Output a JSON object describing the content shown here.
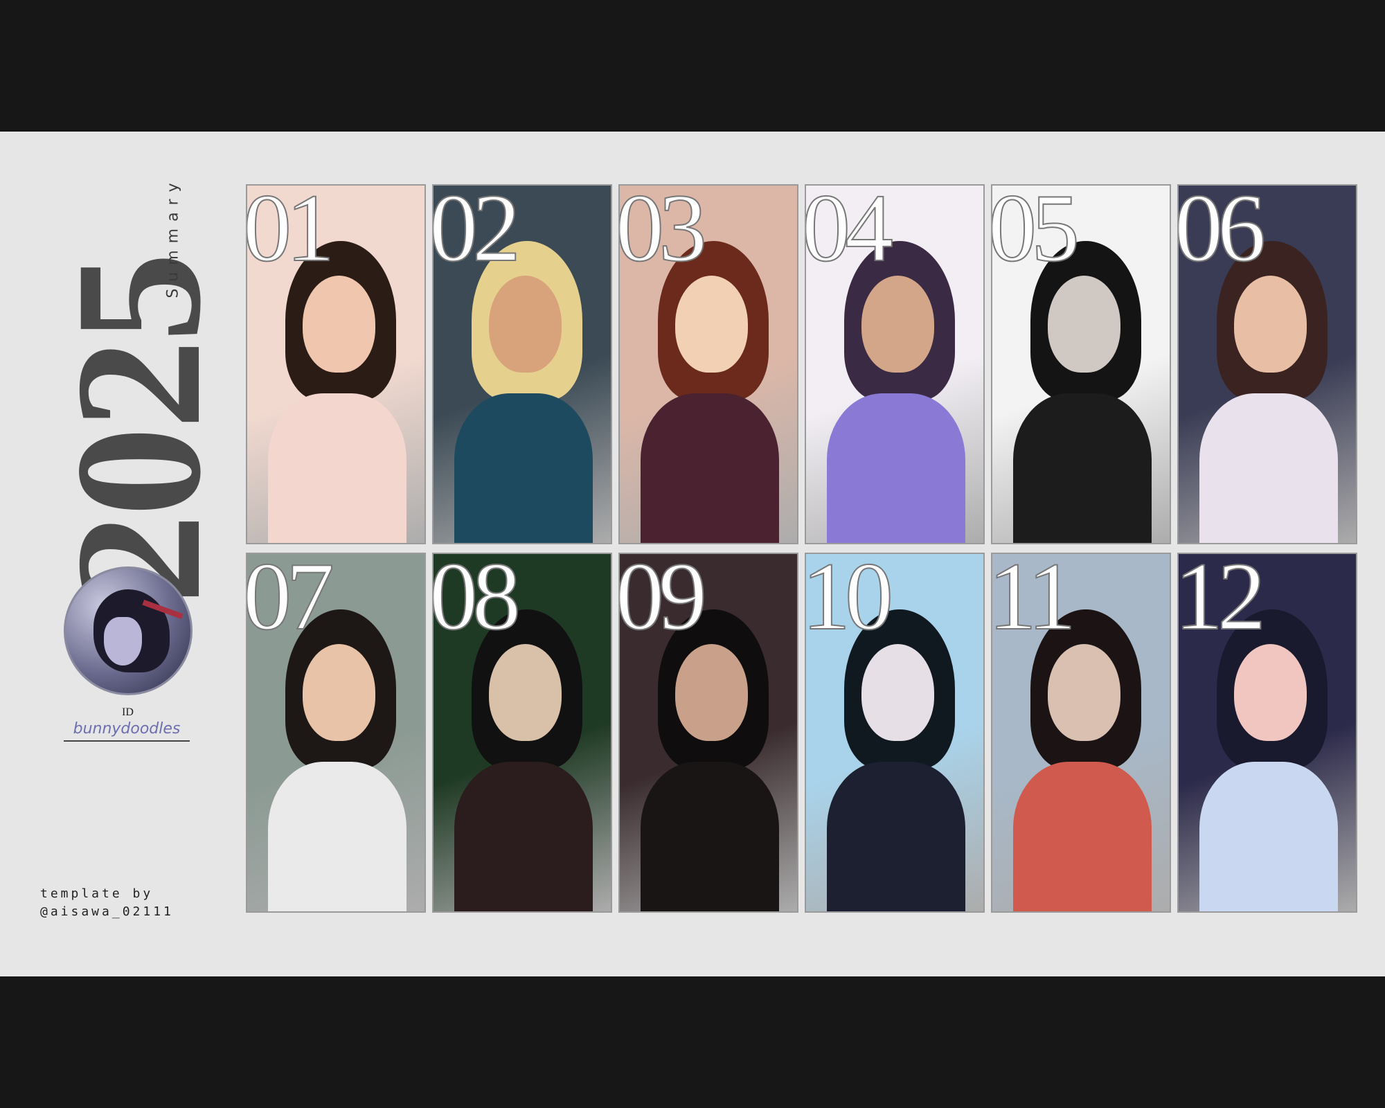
{
  "header": {
    "year": "2025",
    "subtitle": "Summary"
  },
  "profile": {
    "id_label": "ID",
    "handle": "bunnydoodles"
  },
  "credit": {
    "line1": "template by",
    "line2": "@aisawa_02111"
  },
  "months": [
    {
      "num": "01",
      "bg": "#f1d9cf",
      "hair": "#2b1c16",
      "skin": "#f0c7ae",
      "cloth": "#f3d7cf"
    },
    {
      "num": "02",
      "bg": "#3b4a55",
      "hair": "#e6d08e",
      "skin": "#d8a27a",
      "cloth": "#1d4a5e"
    },
    {
      "num": "03",
      "bg": "#dcb7a8",
      "hair": "#6b2a1c",
      "skin": "#f1d0b3",
      "cloth": "#4a2230"
    },
    {
      "num": "04",
      "bg": "#f2eef4",
      "hair": "#3b2a44",
      "skin": "#d3a68a",
      "cloth": "#8a7ad6"
    },
    {
      "num": "05",
      "bg": "#f3f3f3",
      "hair": "#141414",
      "skin": "#cfc8c3",
      "cloth": "#1c1c1c"
    },
    {
      "num": "06",
      "bg": "#3a3c55",
      "hair": "#3a2320",
      "skin": "#e8bfa4",
      "cloth": "#e9e2ec"
    },
    {
      "num": "07",
      "bg": "#8b9a93",
      "hair": "#1d1715",
      "skin": "#e9c3a8",
      "cloth": "#eaeaea"
    },
    {
      "num": "08",
      "bg": "#1f3a24",
      "hair": "#111111",
      "skin": "#d9c0a8",
      "cloth": "#2b1d1d"
    },
    {
      "num": "09",
      "bg": "#3a2c2e",
      "hair": "#0f0d0d",
      "skin": "#c9a08a",
      "cloth": "#1a1515"
    },
    {
      "num": "10",
      "bg": "#a9d3ea",
      "hair": "#101820",
      "skin": "#e6e0e6",
      "cloth": "#1c2030"
    },
    {
      "num": "11",
      "bg": "#a8b8c8",
      "hair": "#1c1414",
      "skin": "#d9c0b0",
      "cloth": "#cf5a4d"
    },
    {
      "num": "12",
      "bg": "#2c2a4a",
      "hair": "#1a1a2e",
      "skin": "#f1c6c0",
      "cloth": "#c9d8f0"
    }
  ]
}
